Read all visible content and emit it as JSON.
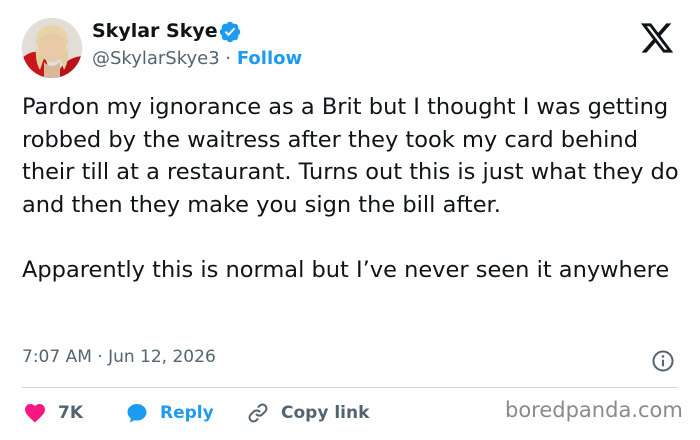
{
  "author": {
    "name": "Skylar Skye",
    "handle": "@SkylarSkye3",
    "separator": " · ",
    "follow_label": "Follow",
    "verified_icon": "verified-badge-icon"
  },
  "platform_icon": "x-logo-icon",
  "tweet": {
    "paragraphs": [
      "Pardon my ignorance as a Brit but I thought I was getting robbed by the waitress after they took my card behind their till at a restaurant. Turns out this is just what they do and then they make you sign the bill after.",
      "Apparently this is normal but I’ve never seen it anywhere"
    ],
    "timestamp": "7:07 AM · Jun 12, 2026"
  },
  "actions": {
    "like_count": "7K",
    "reply_label": "Reply",
    "copy_label": "Copy link"
  },
  "watermark": "boredpanda.com",
  "colors": {
    "accent": "#1d9bf0",
    "like": "#f91880",
    "text": "#0f1419",
    "secondary_text": "#536471",
    "divider": "#cfd9de"
  }
}
